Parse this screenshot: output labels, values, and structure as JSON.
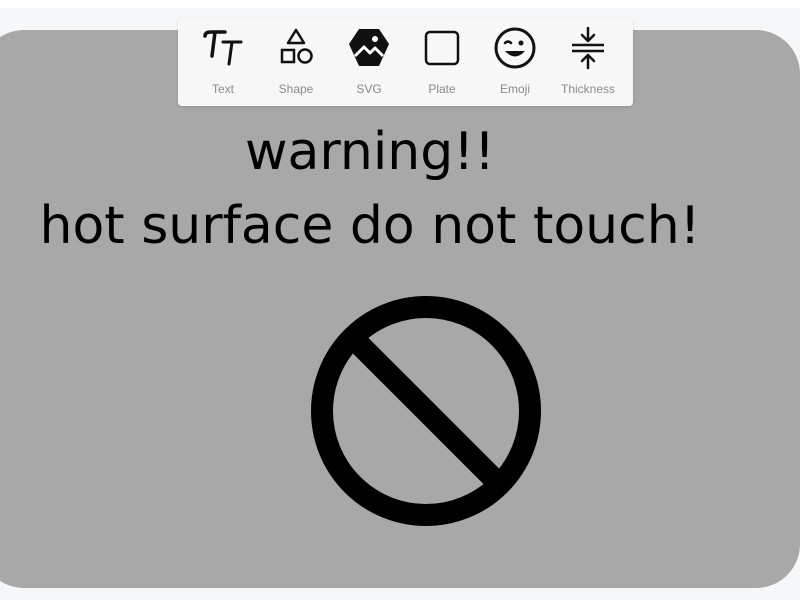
{
  "toolbar": {
    "items": [
      {
        "label": "Text",
        "icon": "text-icon"
      },
      {
        "label": "Shape",
        "icon": "shapes-icon"
      },
      {
        "label": "SVG",
        "icon": "svg-image-icon"
      },
      {
        "label": "Plate",
        "icon": "square-plate-icon"
      },
      {
        "label": "Emoji",
        "icon": "wink-emoji-icon"
      },
      {
        "label": "Thickness",
        "icon": "thickness-compress-icon"
      }
    ]
  },
  "sign": {
    "line1": "warning!!",
    "line2": "hot surface do not touch!",
    "symbol": "prohibition-icon",
    "plate_color": "#a8a8a8",
    "text_color": "#000000"
  }
}
